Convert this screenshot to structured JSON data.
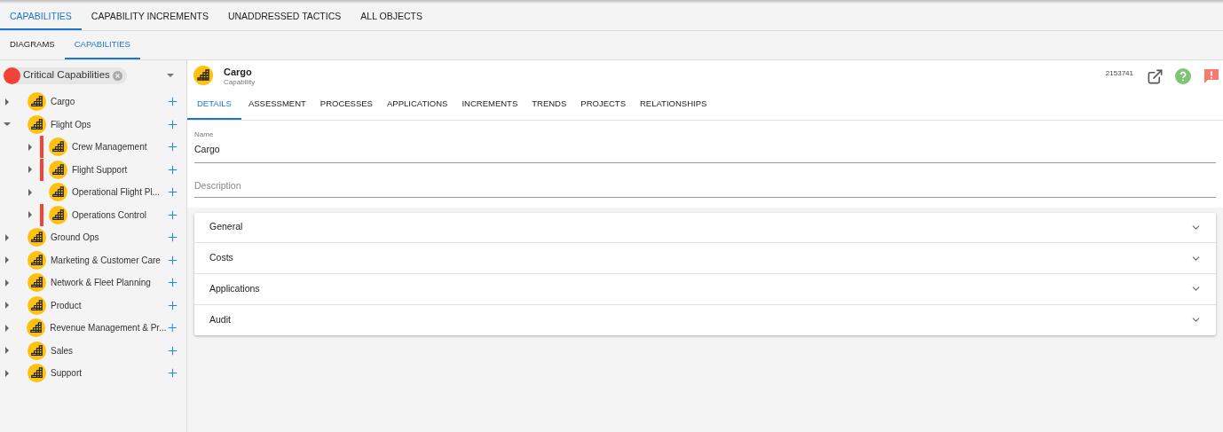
{
  "top_tabs": [
    {
      "label": "CAPABILITIES",
      "selected": true
    },
    {
      "label": "CAPABILITY INCREMENTS",
      "selected": false
    },
    {
      "label": "UNADDRESSED TACTICS",
      "selected": false
    },
    {
      "label": "ALL OBJECTS",
      "selected": false
    }
  ],
  "sub_tabs": [
    {
      "label": "DIAGRAMS",
      "selected": false
    },
    {
      "label": "CAPABILITIES",
      "selected": true
    }
  ],
  "filter": {
    "chip": "Critical Capabilities",
    "color": "#f44336"
  },
  "tree": [
    {
      "label": "Cargo",
      "expanded": false
    },
    {
      "label": "Flight Ops",
      "expanded": true,
      "children": [
        {
          "label": "Crew Management",
          "expanded": false,
          "critical": true
        },
        {
          "label": "Flight Support",
          "expanded": false,
          "critical": true
        },
        {
          "label": "Operational Flight Pl...",
          "expanded": false,
          "critical": false
        },
        {
          "label": "Operations Control",
          "expanded": false,
          "critical": true
        }
      ]
    },
    {
      "label": "Ground Ops",
      "expanded": false
    },
    {
      "label": "Marketing & Customer Care",
      "expanded": false
    },
    {
      "label": "Network & Fleet Planning",
      "expanded": false
    },
    {
      "label": "Product",
      "expanded": false
    },
    {
      "label": "Revenue Management & Pr...",
      "expanded": false
    },
    {
      "label": "Sales",
      "expanded": false
    },
    {
      "label": "Support",
      "expanded": false
    }
  ],
  "detail": {
    "title": "Cargo",
    "subtitle": "Capability",
    "id": "2153741",
    "tabs": [
      {
        "label": "DETAILS",
        "selected": true
      },
      {
        "label": "ASSESSMENT",
        "selected": false
      },
      {
        "label": "PROCESSES",
        "selected": false
      },
      {
        "label": "APPLICATIONS",
        "selected": false
      },
      {
        "label": "INCREMENTS",
        "selected": false
      },
      {
        "label": "TRENDS",
        "selected": false
      },
      {
        "label": "PROJECTS",
        "selected": false
      },
      {
        "label": "RELATIONSHIPS",
        "selected": false
      }
    ],
    "name_field": {
      "label": "Name",
      "value": "Cargo"
    },
    "description_field": {
      "placeholder": "Description"
    },
    "sections": [
      {
        "label": "General",
        "expanded": false
      },
      {
        "label": "Costs",
        "expanded": false
      },
      {
        "label": "Applications",
        "expanded": false
      },
      {
        "label": "Audit",
        "expanded": false
      }
    ]
  }
}
